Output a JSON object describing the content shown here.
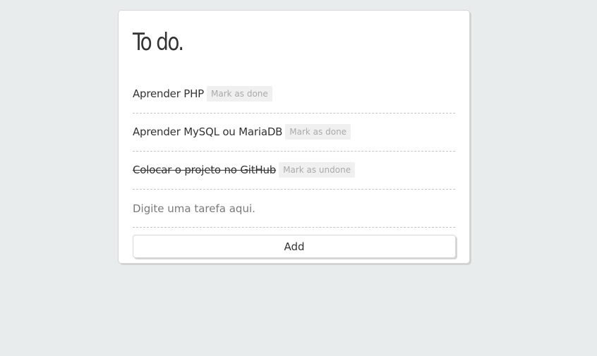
{
  "app": {
    "title": "To do."
  },
  "tasks": [
    {
      "text": "Aprender PHP",
      "done": false,
      "action_label": "Mark as done"
    },
    {
      "text": "Aprender MySQL ou MariaDB",
      "done": false,
      "action_label": "Mark as done"
    },
    {
      "text": "Colocar o projeto no GitHub",
      "done": true,
      "action_label": "Mark as undone"
    }
  ],
  "form": {
    "input_placeholder": "Digite uma tarefa aqui.",
    "input_value": "",
    "add_label": "Add"
  }
}
